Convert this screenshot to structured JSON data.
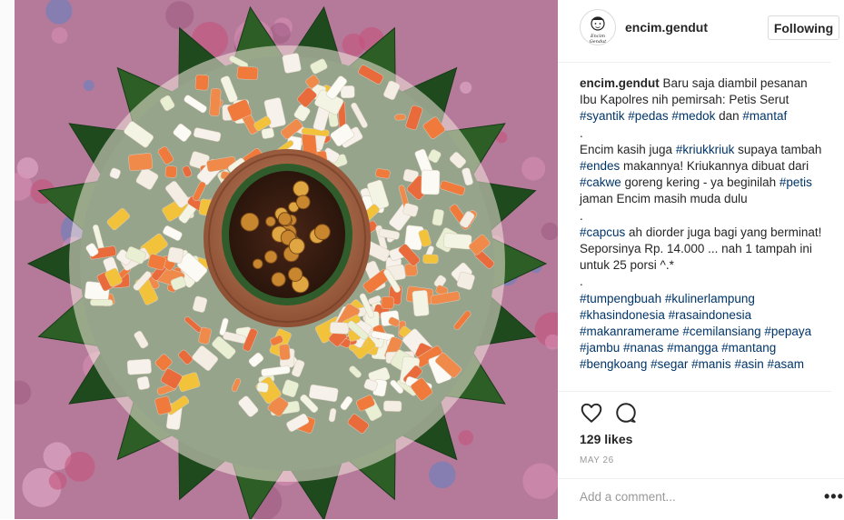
{
  "post": {
    "username": "encim.gendut",
    "follow_label": "Following",
    "avatar_text": "Encim Gendut",
    "caption": {
      "lines": [
        [
          {
            "t": "encim.gendut",
            "k": "user"
          },
          {
            "t": " Baru saja diambil pesanan Ibu Kapolres nih pemirsah: Petis Serut "
          },
          {
            "t": "#syantik",
            "k": "tag"
          },
          {
            "t": " "
          },
          {
            "t": "#pedas",
            "k": "tag"
          },
          {
            "t": " "
          },
          {
            "t": "#medok",
            "k": "tag"
          },
          {
            "t": " dan "
          },
          {
            "t": "#mantaf",
            "k": "tag"
          }
        ],
        [
          {
            "t": "."
          }
        ],
        [
          {
            "t": "Encim kasih juga "
          },
          {
            "t": "#kriukkriuk",
            "k": "tag"
          },
          {
            "t": " supaya tambah "
          },
          {
            "t": "#endes",
            "k": "tag"
          },
          {
            "t": " makannya! Kriukannya dibuat dari "
          },
          {
            "t": "#cakwe",
            "k": "tag"
          },
          {
            "t": " goreng kering - ya beginilah "
          },
          {
            "t": "#petis",
            "k": "tag"
          },
          {
            "t": " jaman Encim masih muda dulu"
          }
        ],
        [
          {
            "t": "."
          }
        ],
        [
          {
            "t": "#capcus",
            "k": "tag"
          },
          {
            "t": " ah diorder juga bagi yang berminat! Seporsinya Rp. 14.000 ... nah 1 tampah ini untuk 25 porsi ^.*"
          }
        ],
        [
          {
            "t": "."
          }
        ],
        [
          {
            "t": "#tumpengbuah",
            "k": "tag"
          },
          {
            "t": " "
          },
          {
            "t": "#kulinerlampung",
            "k": "tag"
          },
          {
            "t": " "
          },
          {
            "t": "#khasindonesia",
            "k": "tag"
          },
          {
            "t": " "
          },
          {
            "t": "#rasaindonesia",
            "k": "tag"
          },
          {
            "t": " "
          },
          {
            "t": "#makanramerame",
            "k": "tag"
          },
          {
            "t": " "
          },
          {
            "t": "#cemilansiang",
            "k": "tag"
          },
          {
            "t": " "
          },
          {
            "t": "#pepaya",
            "k": "tag"
          },
          {
            "t": " "
          },
          {
            "t": "#jambu",
            "k": "tag"
          },
          {
            "t": " "
          },
          {
            "t": "#nanas",
            "k": "tag"
          },
          {
            "t": " "
          },
          {
            "t": "#mangga",
            "k": "tag"
          },
          {
            "t": " "
          },
          {
            "t": "#mantang",
            "k": "tag"
          },
          {
            "t": " "
          },
          {
            "t": "#bengkoang",
            "k": "tag"
          },
          {
            "t": " "
          },
          {
            "t": "#segar",
            "k": "tag"
          },
          {
            "t": " "
          },
          {
            "t": "#manis",
            "k": "tag"
          },
          {
            "t": " "
          },
          {
            "t": "#asin",
            "k": "tag"
          },
          {
            "t": " "
          },
          {
            "t": "#asam",
            "k": "tag"
          }
        ]
      ]
    },
    "likes_label": "129 likes",
    "date_label": "MAY 26",
    "comment_placeholder": "Add a comment...",
    "more_label": "•••",
    "icons": {
      "like": "heart-icon",
      "comment": "comment-icon",
      "more": "more-options-icon"
    }
  },
  "colors": {
    "hashtag": "#003569",
    "text": "#262626",
    "muted": "#999999",
    "border": "#efefef"
  }
}
